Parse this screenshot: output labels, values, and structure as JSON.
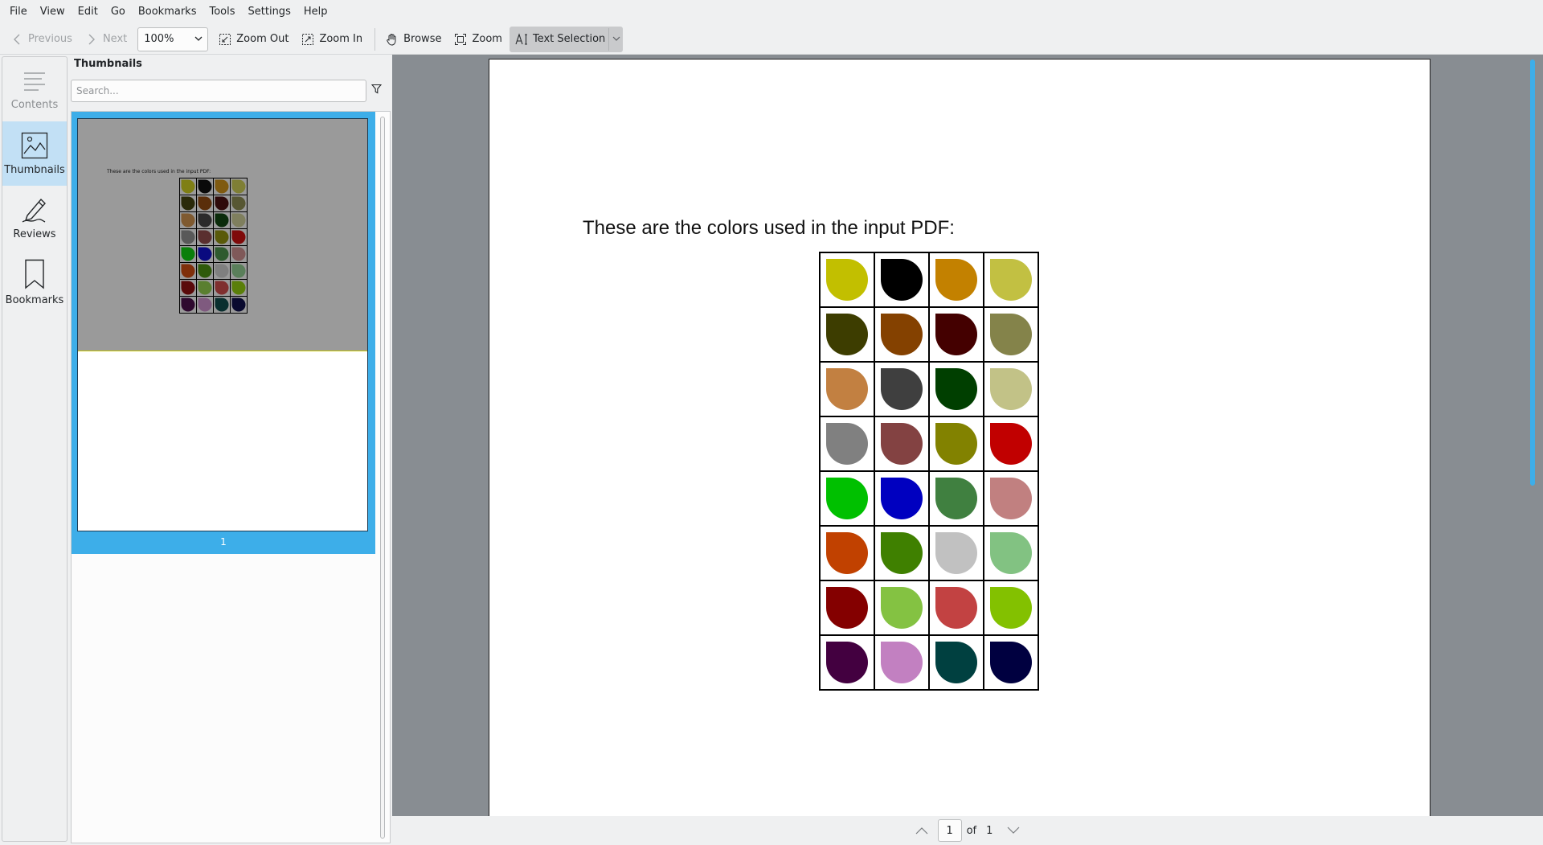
{
  "menu": [
    "File",
    "View",
    "Edit",
    "Go",
    "Bookmarks",
    "Tools",
    "Settings",
    "Help"
  ],
  "toolbar": {
    "previous_label": "Previous",
    "next_label": "Next",
    "zoom_value": "100%",
    "zoom_out_label": "Zoom Out",
    "zoom_in_label": "Zoom In",
    "browse_label": "Browse",
    "zoom_label": "Zoom",
    "text_selection_label": "Text Selection"
  },
  "sidebar_tabs": [
    {
      "label": "Contents",
      "icon": "contents-icon",
      "state": "disabled"
    },
    {
      "label": "Thumbnails",
      "icon": "image-icon",
      "state": "active"
    },
    {
      "label": "Reviews",
      "icon": "pen-icon",
      "state": "normal"
    },
    {
      "label": "Bookmarks",
      "icon": "bookmark-icon",
      "state": "normal"
    }
  ],
  "thumbnails": {
    "title": "Thumbnails",
    "search_placeholder": "Search...",
    "page_number": "1"
  },
  "document": {
    "caption": "These are the colors used in the input PDF:",
    "swatch_colors": [
      [
        "#c2bf00",
        "#000000",
        "#c38100",
        "#c2c042"
      ],
      [
        "#3d3d00",
        "#844100",
        "#440000",
        "#84834a"
      ],
      [
        "#c28041",
        "#3f3f3f",
        "#003f00",
        "#c2c287"
      ],
      [
        "#808080",
        "#834242",
        "#828200",
        "#c10000"
      ],
      [
        "#00c000",
        "#0000c0",
        "#408040",
        "#c18080"
      ],
      [
        "#c14100",
        "#3f8000",
        "#c1c1c1",
        "#82c282"
      ],
      [
        "#840000",
        "#84c242",
        "#c24242",
        "#83c100"
      ],
      [
        "#430040",
        "#c280c1",
        "#004040",
        "#000040"
      ]
    ],
    "thumb_swatch_colors": [
      [
        "#7f7f15",
        "#0a0a0a",
        "#7f5a10",
        "#7f7f35"
      ],
      [
        "#2a2a0a",
        "#5a2e0a",
        "#2e0a0a",
        "#575733"
      ],
      [
        "#7f5a30",
        "#2b2b2b",
        "#0a2b0a",
        "#7f7f5e"
      ],
      [
        "#595959",
        "#5a2f2f",
        "#595a0a",
        "#7f0a0a"
      ],
      [
        "#0a7f0a",
        "#0a0a7f",
        "#2f5a2f",
        "#7f5959"
      ],
      [
        "#7f2f0a",
        "#2f5a0a",
        "#7f7f7f",
        "#5a7f5a"
      ],
      [
        "#5a0a0a",
        "#5a7f30",
        "#7f2f2f",
        "#5a7f0a"
      ],
      [
        "#2f0a2f",
        "#7f5a7f",
        "#0a2f2f",
        "#0a0a2f"
      ]
    ]
  },
  "page_nav": {
    "current_page": "1",
    "of_label": "of",
    "total_pages": "1"
  }
}
